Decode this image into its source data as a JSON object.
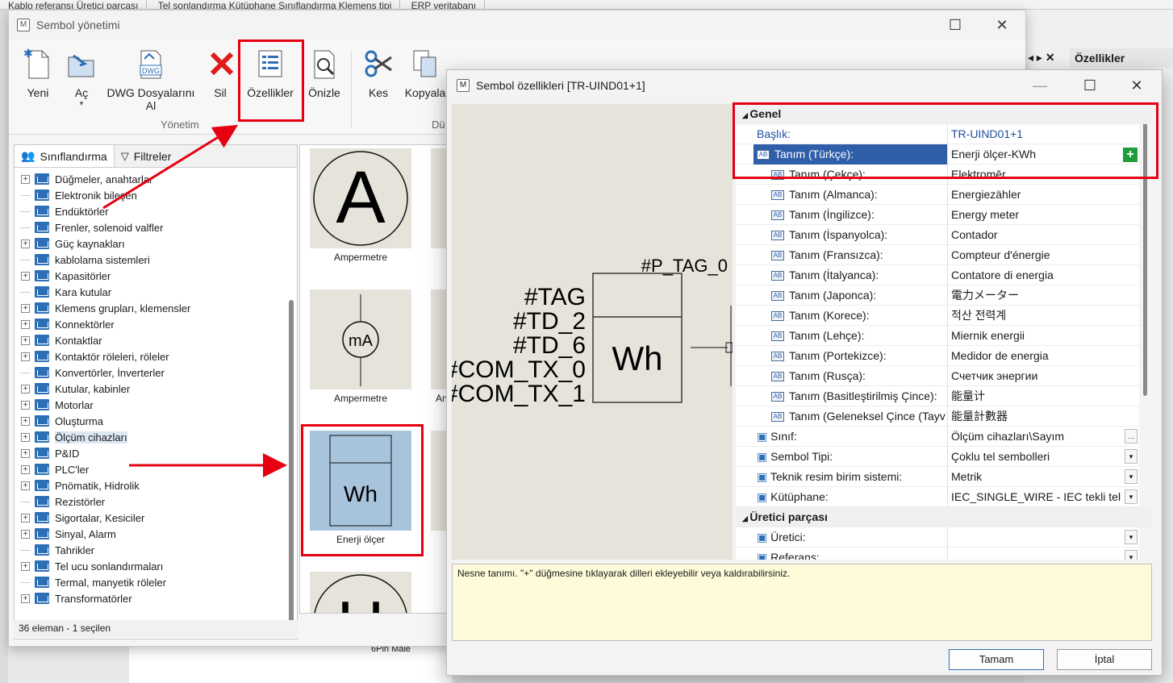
{
  "background": {
    "tabs": [
      "Kablo referansı Üretici parçası",
      "Tel sonlandırma Kütüphane Sınıflandırma Klemens tipi",
      "ERP veritabanı"
    ],
    "properties_header": "Özellikler",
    "bottom_label": "6Pin Male"
  },
  "main_window": {
    "title": "Sembol yönetimi",
    "ribbon": {
      "buttons": [
        "Yeni",
        "Aç",
        "DWG Dosyalarını Al",
        "Sil",
        "Özellikler",
        "Önizle",
        "Kes",
        "Kopyala"
      ],
      "group_label": "Yönetim",
      "group_label_2": "Dü"
    },
    "left_tabs": [
      "Sınıflandırma",
      "Filtreler"
    ],
    "tree": [
      {
        "label": "Düğmeler, anahtarlar",
        "expandable": true
      },
      {
        "label": "Elektronik bileşen",
        "expandable": false
      },
      {
        "label": "Endüktörler",
        "expandable": false
      },
      {
        "label": "Frenler, solenoid valfler",
        "expandable": false
      },
      {
        "label": "Güç kaynakları",
        "expandable": true
      },
      {
        "label": "kablolama sistemleri",
        "expandable": false
      },
      {
        "label": "Kapasitörler",
        "expandable": true
      },
      {
        "label": "Kara kutular",
        "expandable": false
      },
      {
        "label": "Klemens grupları, klemensler",
        "expandable": true
      },
      {
        "label": "Konnektörler",
        "expandable": true
      },
      {
        "label": "Kontaktlar",
        "expandable": true
      },
      {
        "label": "Kontaktör röleleri, röleler",
        "expandable": true
      },
      {
        "label": "Konvertörler, İnverterler",
        "expandable": false
      },
      {
        "label": "Kutular, kabinler",
        "expandable": true
      },
      {
        "label": "Motorlar",
        "expandable": true
      },
      {
        "label": "Oluşturma",
        "expandable": true
      },
      {
        "label": "Ölçüm cihazları",
        "expandable": true,
        "selected": true
      },
      {
        "label": "P&ID",
        "expandable": true
      },
      {
        "label": "PLC'ler",
        "expandable": true
      },
      {
        "label": "Pnömatik, Hidrolik",
        "expandable": true
      },
      {
        "label": "Rezistörler",
        "expandable": false
      },
      {
        "label": "Sigortalar, Kesiciler",
        "expandable": true
      },
      {
        "label": "Sinyal, Alarm",
        "expandable": true
      },
      {
        "label": "Tahrikler",
        "expandable": false
      },
      {
        "label": "Tel ucu sonlandırmaları",
        "expandable": true
      },
      {
        "label": "Termal, manyetik röleler",
        "expandable": false
      },
      {
        "label": "Transformatörler",
        "expandable": true
      }
    ],
    "status": "36 eleman - 1 seçilen",
    "tiles": [
      {
        "caption": "Ampermetre",
        "glyph": "A"
      },
      {
        "caption": "Ampermetre",
        "glyph": "mA"
      },
      {
        "caption": "Enerji ölçer",
        "glyph": "Wh",
        "selected": true
      },
      {
        "caption": "",
        "glyph": "U"
      }
    ],
    "partial_caption": "An"
  },
  "dialog": {
    "title": "Sembol özellikleri [TR-UIND01+1]",
    "preview": {
      "tags": [
        "#TAG",
        "#TD_2",
        "#TD_6",
        "#COM_TX_0",
        "#COM_TX_1"
      ],
      "top_tag": "#P_TAG_0",
      "unit": "Wh"
    },
    "categories": {
      "general": "Genel",
      "manufacturer": "Üretici parçası"
    },
    "rows": [
      {
        "key": "Başlık:",
        "value": "TR-UIND01+1",
        "type": "title"
      },
      {
        "key": "Tanım (Türkçe):",
        "value": "Enerji ölçer-KWh",
        "type": "lang",
        "highlight": true
      },
      {
        "key": "Tanım (Çekçe):",
        "value": "Elektroměr",
        "type": "lang"
      },
      {
        "key": "Tanım (Almanca):",
        "value": "Energiezähler",
        "type": "lang"
      },
      {
        "key": "Tanım (İngilizce):",
        "value": "Energy meter",
        "type": "lang"
      },
      {
        "key": "Tanım (İspanyolca):",
        "value": "Contador",
        "type": "lang"
      },
      {
        "key": "Tanım (Fransızca):",
        "value": "Compteur d'énergie",
        "type": "lang"
      },
      {
        "key": "Tanım (İtalyanca):",
        "value": "Contatore di energia",
        "type": "lang"
      },
      {
        "key": "Tanım (Japonca):",
        "value": "電力メーター",
        "type": "lang"
      },
      {
        "key": "Tanım (Korece):",
        "value": "적산 전력계",
        "type": "lang"
      },
      {
        "key": "Tanım (Lehçe):",
        "value": "Miernik energii",
        "type": "lang"
      },
      {
        "key": "Tanım (Portekizce):",
        "value": "Medidor de energia",
        "type": "lang"
      },
      {
        "key": "Tanım (Rusça):",
        "value": "Счетчик энергии",
        "type": "lang"
      },
      {
        "key": "Tanım (Basitleştirilmiş Çince):",
        "value": "能量计",
        "type": "lang"
      },
      {
        "key": "Tanım (Geleneksel Çince (Tayv",
        "value": "能量計數器",
        "type": "lang"
      },
      {
        "key": "Sınıf:",
        "value": "Ölçüm cihazları\\Sayım",
        "type": "browse"
      },
      {
        "key": "Sembol Tipi:",
        "value": "Çoklu tel sembolleri",
        "type": "dropdown"
      },
      {
        "key": "Teknik resim birim sistemi:",
        "value": "Metrik",
        "type": "dropdown"
      },
      {
        "key": "Kütüphane:",
        "value": "IEC_SINGLE_WIRE - IEC tekli tel",
        "type": "dropdown"
      }
    ],
    "manufacturer_rows": [
      {
        "key": "Üretici:",
        "value": "",
        "type": "dropdown"
      },
      {
        "key": "Referans:",
        "value": "",
        "type": "dropdown"
      }
    ],
    "description": "Nesne tanımı. \"+\" düğmesine tıklayarak dilleri ekleyebilir veya kaldırabilirsiniz.",
    "ok": "Tamam",
    "cancel": "İptal"
  },
  "colors": {
    "annotation": "#e60012",
    "selection": "#2f5fa8",
    "accent_green": "#1e9e3a"
  }
}
